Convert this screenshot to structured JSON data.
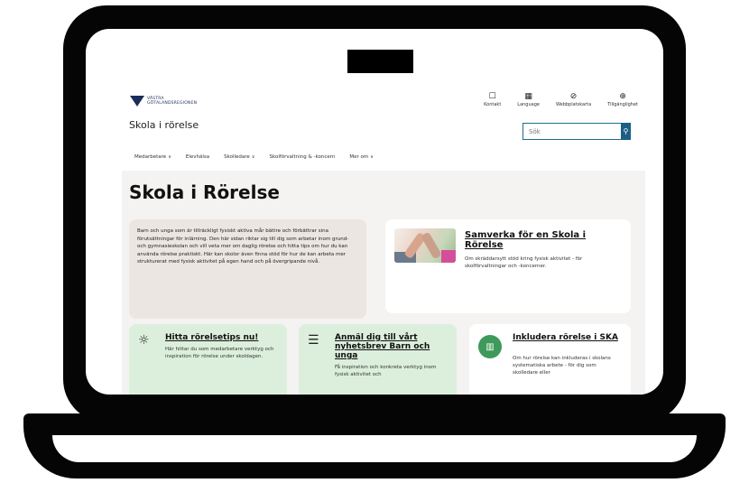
{
  "site": {
    "logo_text": [
      "VÄSTRA",
      "GÖTALANDSREGIONEN"
    ],
    "title": "Skola i rörelse",
    "utility": [
      {
        "icon": "contact-icon",
        "glyph": "☐",
        "label": "Kontakt"
      },
      {
        "icon": "language-icon",
        "glyph": "▦",
        "label": "Language"
      },
      {
        "icon": "sitemap-icon",
        "glyph": "⊘",
        "label": "Webbplatskarta"
      },
      {
        "icon": "accessibility-icon",
        "glyph": "⊕",
        "label": "Tillgänglighet"
      }
    ],
    "search": {
      "placeholder": "Sök",
      "button_icon": "search-icon"
    },
    "nav": [
      {
        "label": "Medarbetare",
        "dropdown": true
      },
      {
        "label": "Elevhälsa",
        "dropdown": false
      },
      {
        "label": "Skolledare",
        "dropdown": true
      },
      {
        "label": "Skolförvaltning & -koncern",
        "dropdown": false
      },
      {
        "label": "Mer om",
        "dropdown": true
      }
    ]
  },
  "main": {
    "page_title": "Skola i Rörelse",
    "intro": "Barn och unga som är tillräckligt fysiskt aktiva mår bättre och förbättrar sina förutsättningar för inlärning. Den här sidan riktar sig till dig som arbetar inom grund- och gymnasieskolan och vill veta mer om daglig rörelse och hitta tips om hur du kan använda rörelse praktiskt. Här kan skolor även finna stöd för hur de kan arbeta mer strukturerat med fysisk aktivitet på egen hand och på övergripande nivå.",
    "feature": {
      "heading": "Samverka för en Skola i Rörelse",
      "text": "Om skräddarsytt stöd kring fysisk aktivitet - för skolförvaltningar och -koncerner."
    },
    "cards": [
      {
        "icon": "lightbulb-icon",
        "heading": "Hitta rörelsetips nu!",
        "text": "Här hittar du som medarbetare verktyg och inspiration för rörelse under skoldagen."
      },
      {
        "icon": "newsletter-icon",
        "heading": "Anmäl dig till vårt nyhetsbrev Barn och unga",
        "text": "Få inspiration och konkreta verktyg inom fysisk aktivitet och"
      },
      {
        "icon": "chart-icon",
        "heading": "Inkludera rörelse i SKA",
        "text": "Om hur rörelse kan inkluderas i skolans systematiska arbete - för dig som skolledare eller"
      }
    ]
  },
  "colors": {
    "accent": "#1b5f86",
    "card_green": "#dcefdc",
    "intro_bg": "#ebe6e1",
    "content_bg": "#f4f3f1"
  }
}
